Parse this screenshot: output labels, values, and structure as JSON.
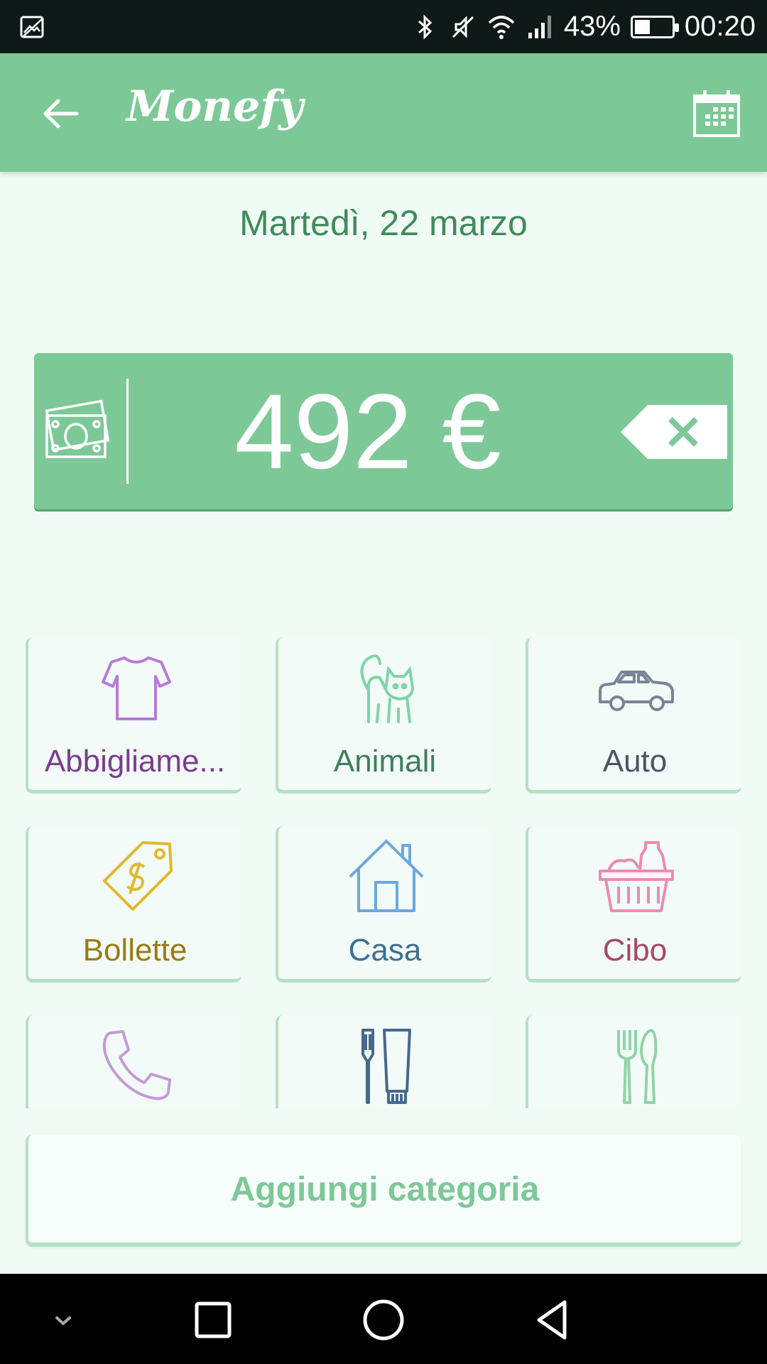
{
  "status_bar": {
    "battery": "43%",
    "battery_level": 0.43,
    "time": "00:20",
    "icons": [
      "image-icon",
      "bluetooth-icon",
      "mute-icon",
      "wifi-icon",
      "signal-icon",
      "battery-icon"
    ]
  },
  "app_bar": {
    "title": "Monefy",
    "back_icon": "arrow-left-icon",
    "calendar_icon": "calendar-icon"
  },
  "date": "Martedì, 22 marzo",
  "amount": {
    "value": "492 €",
    "money_icon": "banknotes-icon",
    "clear_icon": "backspace-icon"
  },
  "categories": [
    {
      "label": "Abbigliame...",
      "icon": "shirt-icon",
      "color": "#7b3d8f"
    },
    {
      "label": "Animali",
      "icon": "cat-icon",
      "color": "#3f7d5c"
    },
    {
      "label": "Auto",
      "icon": "car-icon",
      "color": "#4a5468"
    },
    {
      "label": "Bollette",
      "icon": "price-tag-icon",
      "color": "#9b7a12"
    },
    {
      "label": "Casa",
      "icon": "house-icon",
      "color": "#3d6f92"
    },
    {
      "label": "Cibo",
      "icon": "basket-icon",
      "color": "#a8476a"
    },
    {
      "label": "",
      "icon": "phone-icon",
      "color": "#9a6fb3"
    },
    {
      "label": "",
      "icon": "toothbrush-icon",
      "color": "#3d5f84"
    },
    {
      "label": "",
      "icon": "fork-knife-icon",
      "color": "#63b47e"
    }
  ],
  "add_category": "Aggiungi categoria",
  "nav_bar": {
    "icons": [
      "chevron-down-icon",
      "recent-apps-icon",
      "home-icon",
      "back-icon"
    ]
  }
}
